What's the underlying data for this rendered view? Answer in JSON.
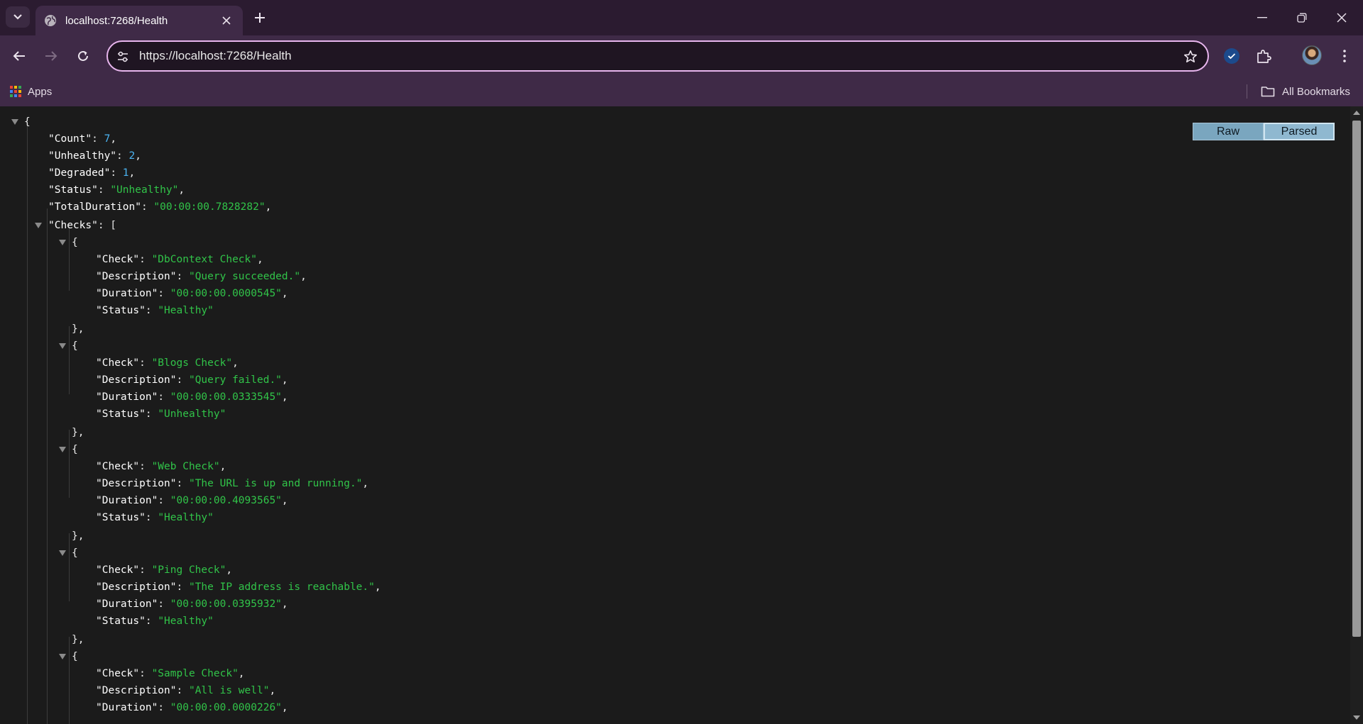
{
  "browser": {
    "tab_title": "localhost:7268/Health",
    "url": "https://localhost:7268/Health",
    "bookmarks": {
      "apps_label": "Apps",
      "all_bookmarks_label": "All Bookmarks"
    }
  },
  "viewer": {
    "raw_label": "Raw",
    "parsed_label": "Parsed",
    "active_view": "Parsed"
  },
  "json": {
    "count_key": "\"Count\"",
    "count_value": "7",
    "unhealthy_key": "\"Unhealthy\"",
    "unhealthy_value": "2",
    "degraded_key": "\"Degraded\"",
    "degraded_value": "1",
    "status_key": "\"Status\"",
    "status_value": "\"Unhealthy\"",
    "total_duration_key": "\"TotalDuration\"",
    "total_duration_value": "\"00:00:00.7828282\"",
    "checks_key": "\"Checks\"",
    "checks": [
      {
        "check": "\"DbContext Check\"",
        "description": "\"Query succeeded.\"",
        "duration": "\"00:00:00.0000545\"",
        "status": "\"Healthy\""
      },
      {
        "check": "\"Blogs Check\"",
        "description": "\"Query failed.\"",
        "duration": "\"00:00:00.0333545\"",
        "status": "\"Unhealthy\""
      },
      {
        "check": "\"Web Check\"",
        "description": "\"The URL is up and running.\"",
        "duration": "\"00:00:00.4093565\"",
        "status": "\"Healthy\""
      },
      {
        "check": "\"Ping Check\"",
        "description": "\"The IP address is reachable.\"",
        "duration": "\"00:00:00.0395932\"",
        "status": "\"Healthy\""
      },
      {
        "check": "\"Sample Check\"",
        "description": "\"All is well\"",
        "duration": "\"00:00:00.0000226\""
      }
    ],
    "labels": {
      "check": "\"Check\"",
      "description": "\"Description\"",
      "duration": "\"Duration\"",
      "status": "\"Status\""
    }
  },
  "colors": {
    "json_string": "#31c449",
    "json_number": "#4bb4f2",
    "omnibox_border": "#e8b6ee",
    "toolbar_bg": "#3f2a47"
  }
}
